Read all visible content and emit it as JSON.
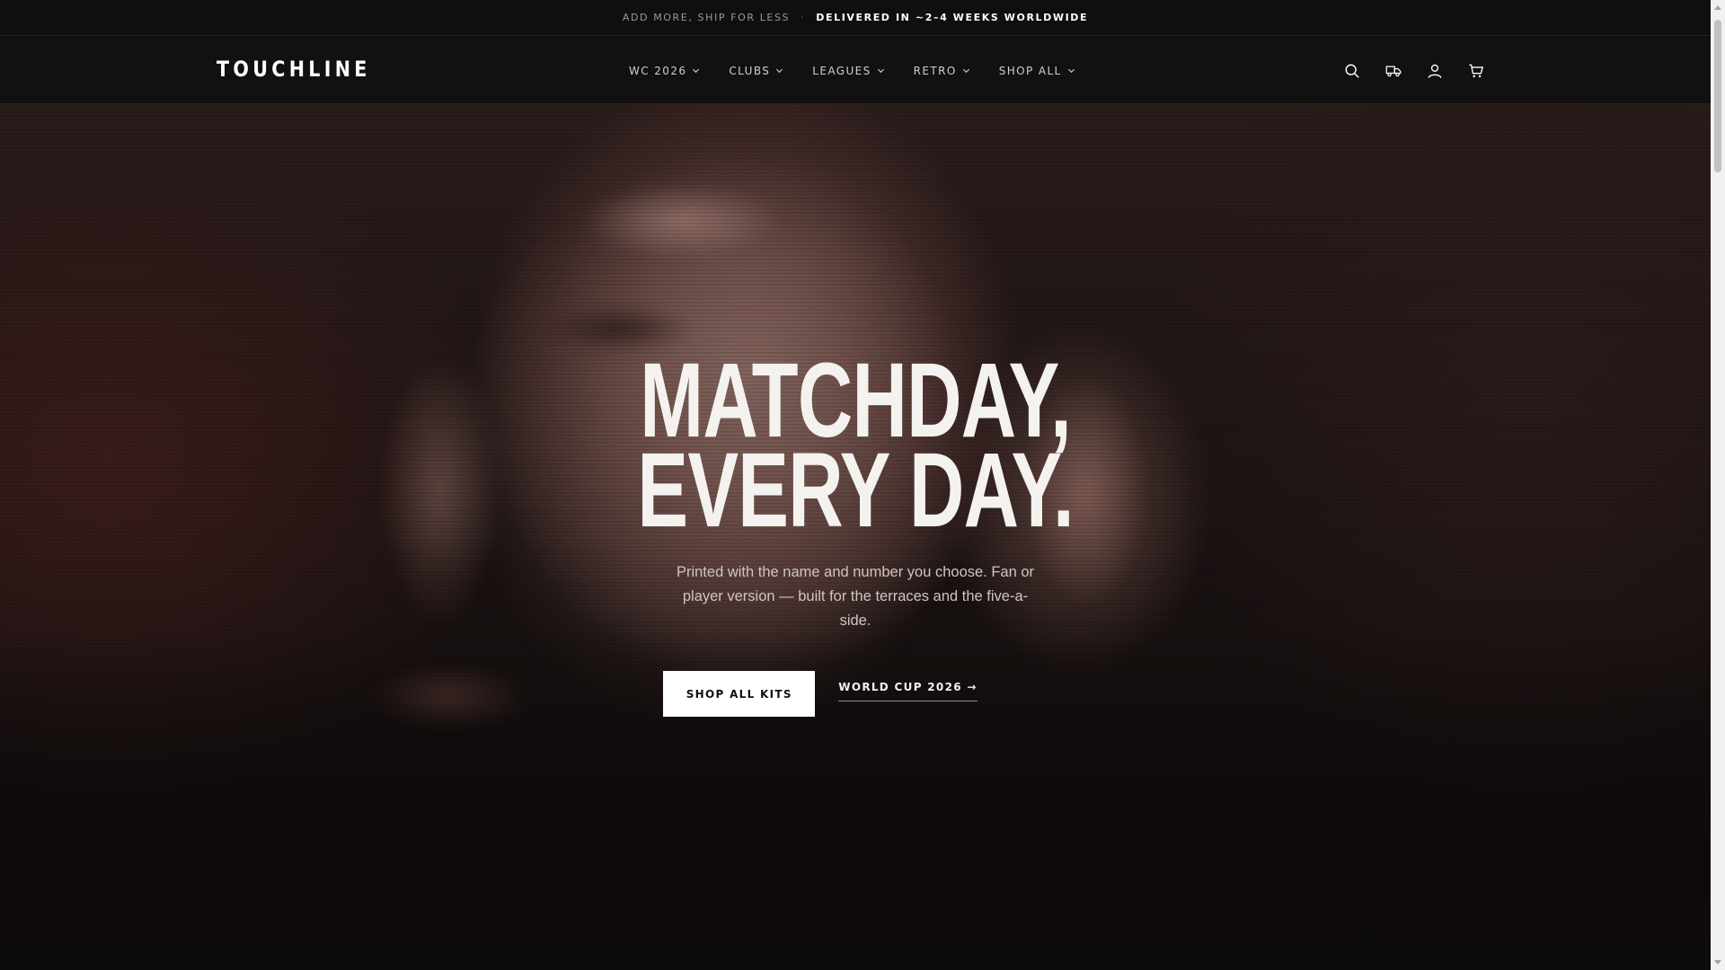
{
  "announcement": {
    "left_text": "ADD MORE, SHIP FOR LESS",
    "separator": "·",
    "right_text": "DELIVERED IN ~2–4 WEEKS WORLDWIDE"
  },
  "header": {
    "logo": "TOUCHLINE",
    "nav": [
      {
        "label": "WC 2026"
      },
      {
        "label": "CLUBS"
      },
      {
        "label": "LEAGUES"
      },
      {
        "label": "RETRO"
      },
      {
        "label": "SHOP ALL"
      }
    ],
    "icons": [
      "search-icon",
      "delivery-truck-icon",
      "account-icon",
      "cart-icon"
    ]
  },
  "hero": {
    "headline_line1": "MATCHDAY,",
    "headline_line2": "EVERY DAY.",
    "subcopy": "Printed with the name and number you choose. Fan or player version — built for the terraces and the five-a-side.",
    "primary_cta": "SHOP ALL KITS",
    "secondary_cta": "WORLD CUP 2026 →"
  },
  "colors": {
    "announcement_bg": "#0f0f0f",
    "header_bg": "#111111",
    "cta_bg": "#ffffff",
    "headline": "#f4f2ef"
  }
}
